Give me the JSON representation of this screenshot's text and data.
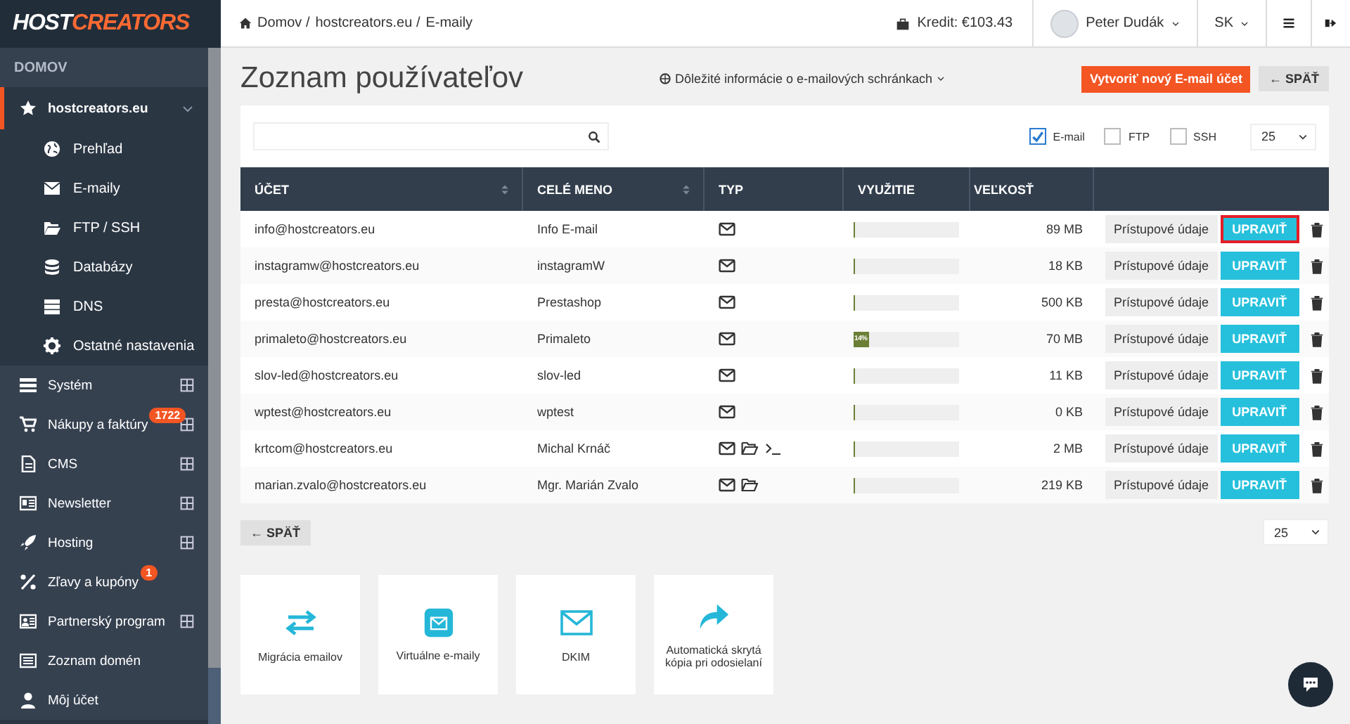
{
  "logo": [
    "HOST",
    "CREATORS"
  ],
  "sidebar": {
    "section": "DOMOV",
    "items": [
      {
        "label": "hostcreators.eu",
        "selected": true,
        "expanded": true,
        "children": [
          {
            "label": "Prehľad"
          },
          {
            "label": "E-maily"
          },
          {
            "label": "FTP / SSH"
          },
          {
            "label": "Databázy"
          },
          {
            "label": "DNS"
          },
          {
            "label": "Ostatné nastavenia"
          }
        ]
      },
      {
        "label": "Systém",
        "selected": false,
        "expanded": false
      },
      {
        "label": "Nákupy a faktúry",
        "badge": "1722",
        "selected": false,
        "expanded": false
      },
      {
        "label": "CMS",
        "selected": false,
        "expanded": false
      },
      {
        "label": "Newsletter",
        "selected": false,
        "expanded": false
      },
      {
        "label": "Hosting",
        "selected": false,
        "expanded": false
      },
      {
        "label": "Zľavy a kupóny",
        "badge": "1",
        "selected": false
      },
      {
        "label": "Partnerský program",
        "selected": false,
        "expanded": false
      },
      {
        "label": "Zoznam domén",
        "selected": false
      },
      {
        "label": "Môj účet",
        "selected": false
      }
    ]
  },
  "topbar": {
    "breadcrumb": [
      "Domov /",
      "hostcreators.eu /",
      "E-maily"
    ],
    "credit": "Kredit: €103.43",
    "user": "Peter Dudák",
    "language": "SK"
  },
  "header": {
    "title": "Zoznam používateľov",
    "info_link": "Dôležité informácie o e-mailových schránkach",
    "create_button": "Vytvoriť nový E-mail účet",
    "back_button": "← SPÄŤ"
  },
  "filters": {
    "checkboxes": [
      {
        "label": "E-mail",
        "checked": true
      },
      {
        "label": "FTP",
        "checked": false
      },
      {
        "label": "SSH",
        "checked": false
      }
    ],
    "page_size": "25"
  },
  "table": {
    "columns": [
      {
        "label": "ÚČET",
        "sortable": true
      },
      {
        "label": "CELÉ MENO",
        "sortable": true
      },
      {
        "label": "TYP",
        "sortable": false
      },
      {
        "label": "VYUŽITIE",
        "sortable": false
      },
      {
        "label": "VEĽKOSŤ",
        "sortable": false
      }
    ],
    "rows": [
      {
        "account": "info@hostcreators.eu",
        "name": "Info E-mail",
        "types": [
          {
            "kind": "email"
          }
        ],
        "usage": {
          "level": 0.01
        },
        "size": "89 MB",
        "credentials_button": "Prístupové údaje",
        "edit_button": "UPRAVIŤ",
        "highlighted": true
      },
      {
        "account": "instagramw@hostcreators.eu",
        "name": "instagramW",
        "types": [
          {
            "kind": "email"
          }
        ],
        "usage": {
          "level": 0
        },
        "size": "18 KB",
        "credentials_button": "Prístupové údaje",
        "edit_button": "UPRAVIŤ",
        "highlighted": false
      },
      {
        "account": "presta@hostcreators.eu",
        "name": "Prestashop",
        "types": [
          {
            "kind": "email"
          }
        ],
        "usage": {
          "level": 0
        },
        "size": "500 KB",
        "credentials_button": "Prístupové údaje",
        "edit_button": "UPRAVIŤ",
        "highlighted": false
      },
      {
        "account": "primaleto@hostcreators.eu",
        "name": "Primaleto",
        "types": [
          {
            "kind": "email"
          }
        ],
        "usage": {
          "level": 0.14,
          "label": "14%"
        },
        "size": "70 MB",
        "credentials_button": "Prístupové údaje",
        "edit_button": "UPRAVIŤ",
        "highlighted": false
      },
      {
        "account": "slov-led@hostcreators.eu",
        "name": "slov-led",
        "types": [
          {
            "kind": "email"
          }
        ],
        "usage": {
          "level": 0
        },
        "size": "11 KB",
        "credentials_button": "Prístupové údaje",
        "edit_button": "UPRAVIŤ",
        "highlighted": false
      },
      {
        "account": "wptest@hostcreators.eu",
        "name": "wptest",
        "types": [
          {
            "kind": "email"
          }
        ],
        "usage": {
          "level": 0
        },
        "size": "0 KB",
        "credentials_button": "Prístupové údaje",
        "edit_button": "UPRAVIŤ",
        "highlighted": false
      },
      {
        "account": "krtcom@hostcreators.eu",
        "name": "Michal Krnáč",
        "types": [
          {
            "kind": "email"
          },
          {
            "kind": "ftp"
          },
          {
            "kind": "ssh"
          }
        ],
        "usage": {
          "level": 0
        },
        "size": "2 MB",
        "credentials_button": "Prístupové údaje",
        "edit_button": "UPRAVIŤ",
        "highlighted": false
      },
      {
        "account": "marian.zvalo@hostcreators.eu",
        "name": "Mgr. Marián Zvalo",
        "types": [
          {
            "kind": "email"
          },
          {
            "kind": "ftp"
          }
        ],
        "usage": {
          "level": 0
        },
        "size": "219 KB",
        "credentials_button": "Prístupové údaje",
        "edit_button": "UPRAVIŤ",
        "highlighted": false
      }
    ]
  },
  "footer": {
    "back_button": "← SPÄŤ",
    "page_size": "25"
  },
  "tiles": [
    {
      "label": "Migrácia emailov"
    },
    {
      "label": "Virtuálne e-maily"
    },
    {
      "label": "DKIM"
    },
    {
      "label": "Automatická skrytá kópia pri odosielaní"
    }
  ]
}
